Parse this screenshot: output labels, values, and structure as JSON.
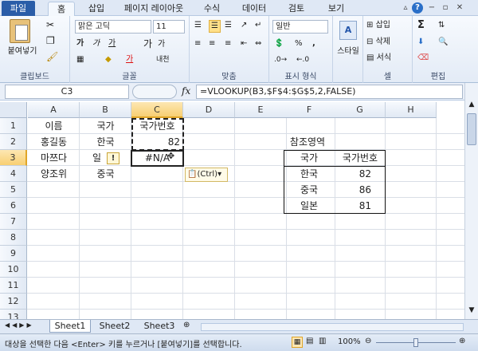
{
  "tabs": {
    "file": "파일",
    "items": [
      "홈",
      "삽입",
      "페이지 레이아웃",
      "수식",
      "데이터",
      "검토",
      "보기"
    ]
  },
  "ribbon": {
    "clipboard": {
      "paste": "붙여넣기",
      "label": "클립보드"
    },
    "font": {
      "name": "맑은 고딕",
      "size": "11",
      "bold": "가",
      "italic": "가",
      "underline": "가",
      "grow": "가",
      "shrink": "가",
      "fontcolor": "가",
      "phonetic": "내천",
      "label": "글꼴"
    },
    "align": {
      "label": "맞춤"
    },
    "number": {
      "format": "일반",
      "percent": "%",
      "comma": ",",
      "label": "표시 형식"
    },
    "style": {
      "label": "스타일"
    },
    "cells": {
      "insert": "삽입",
      "delete": "삭제",
      "format": "서식",
      "label": "셀"
    },
    "editing": {
      "sigma": "Σ",
      "label": "편집"
    }
  },
  "formula_bar": {
    "name_box": "C3",
    "fx": "fx",
    "formula": "=VLOOKUP(B3,$F$4:$G$5,2,FALSE)"
  },
  "columns": [
    "A",
    "B",
    "C",
    "D",
    "E",
    "F",
    "G",
    "H"
  ],
  "rows": [
    "1",
    "2",
    "3",
    "4",
    "5",
    "6",
    "7",
    "8",
    "9",
    "10",
    "11",
    "12",
    "13"
  ],
  "cells": {
    "A1": "이름",
    "B1": "국가",
    "C1": "국가번호",
    "A2": "홍길동",
    "B2": "한국",
    "C2": "82",
    "A3": "마쯔다",
    "B3": "일",
    "C3": "#N/A",
    "A4": "양조위",
    "B4": "중국",
    "F2": "참조영역",
    "F3": "국가",
    "G3": "국가번호",
    "F4": "한국",
    "G4": "82",
    "F5": "중국",
    "G5": "86",
    "F6": "일본",
    "G6": "81"
  },
  "paste_options": "(Ctrl)",
  "sheet_tabs": [
    "Sheet1",
    "Sheet2",
    "Sheet3"
  ],
  "status": {
    "message": "대상을 선택한 다음 <Enter> 키를 누르거나 [붙여넣기]를 선택합니다.",
    "zoom": "100%"
  }
}
